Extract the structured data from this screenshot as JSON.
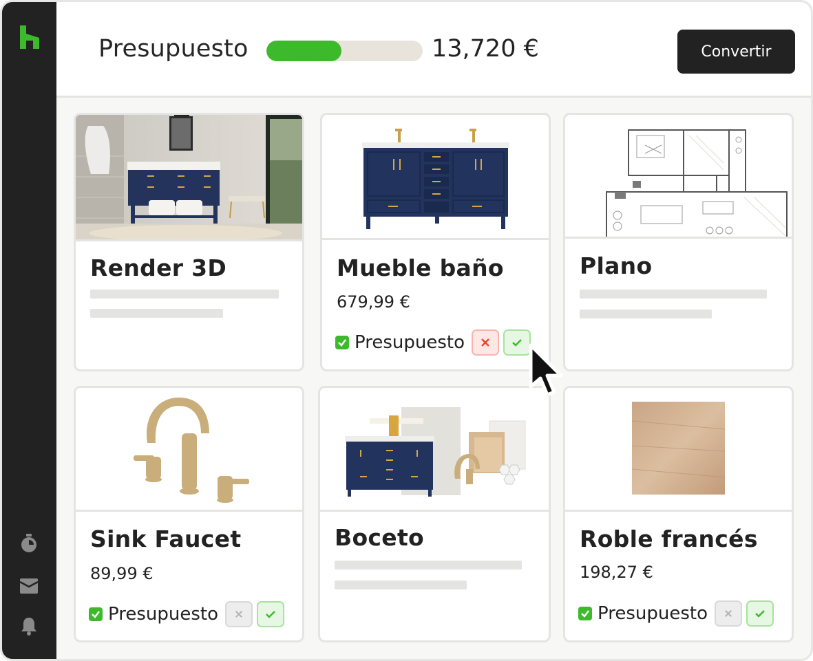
{
  "app": {
    "brand_color": "#3dba2c",
    "sidebar_icons": [
      "home-logo-icon",
      "stopwatch-icon",
      "inbox-icon",
      "bell-icon"
    ]
  },
  "header": {
    "budget_label": "Presupuesto",
    "budget_amount": "13,720 €",
    "budget_progress": 0.48,
    "convert_label": "Convertir"
  },
  "cards": [
    {
      "title": "Render 3D"
    },
    {
      "title": "Mueble baño",
      "price": "679,99 €",
      "budget_label": "Presupuesto"
    },
    {
      "title": "Plano"
    },
    {
      "title": "Sink Faucet",
      "price": "89,99 €",
      "budget_label": "Presupuesto"
    },
    {
      "title": "Boceto"
    },
    {
      "title": "Roble francés",
      "price": "198,27 €",
      "budget_label": "Presupuesto"
    }
  ]
}
